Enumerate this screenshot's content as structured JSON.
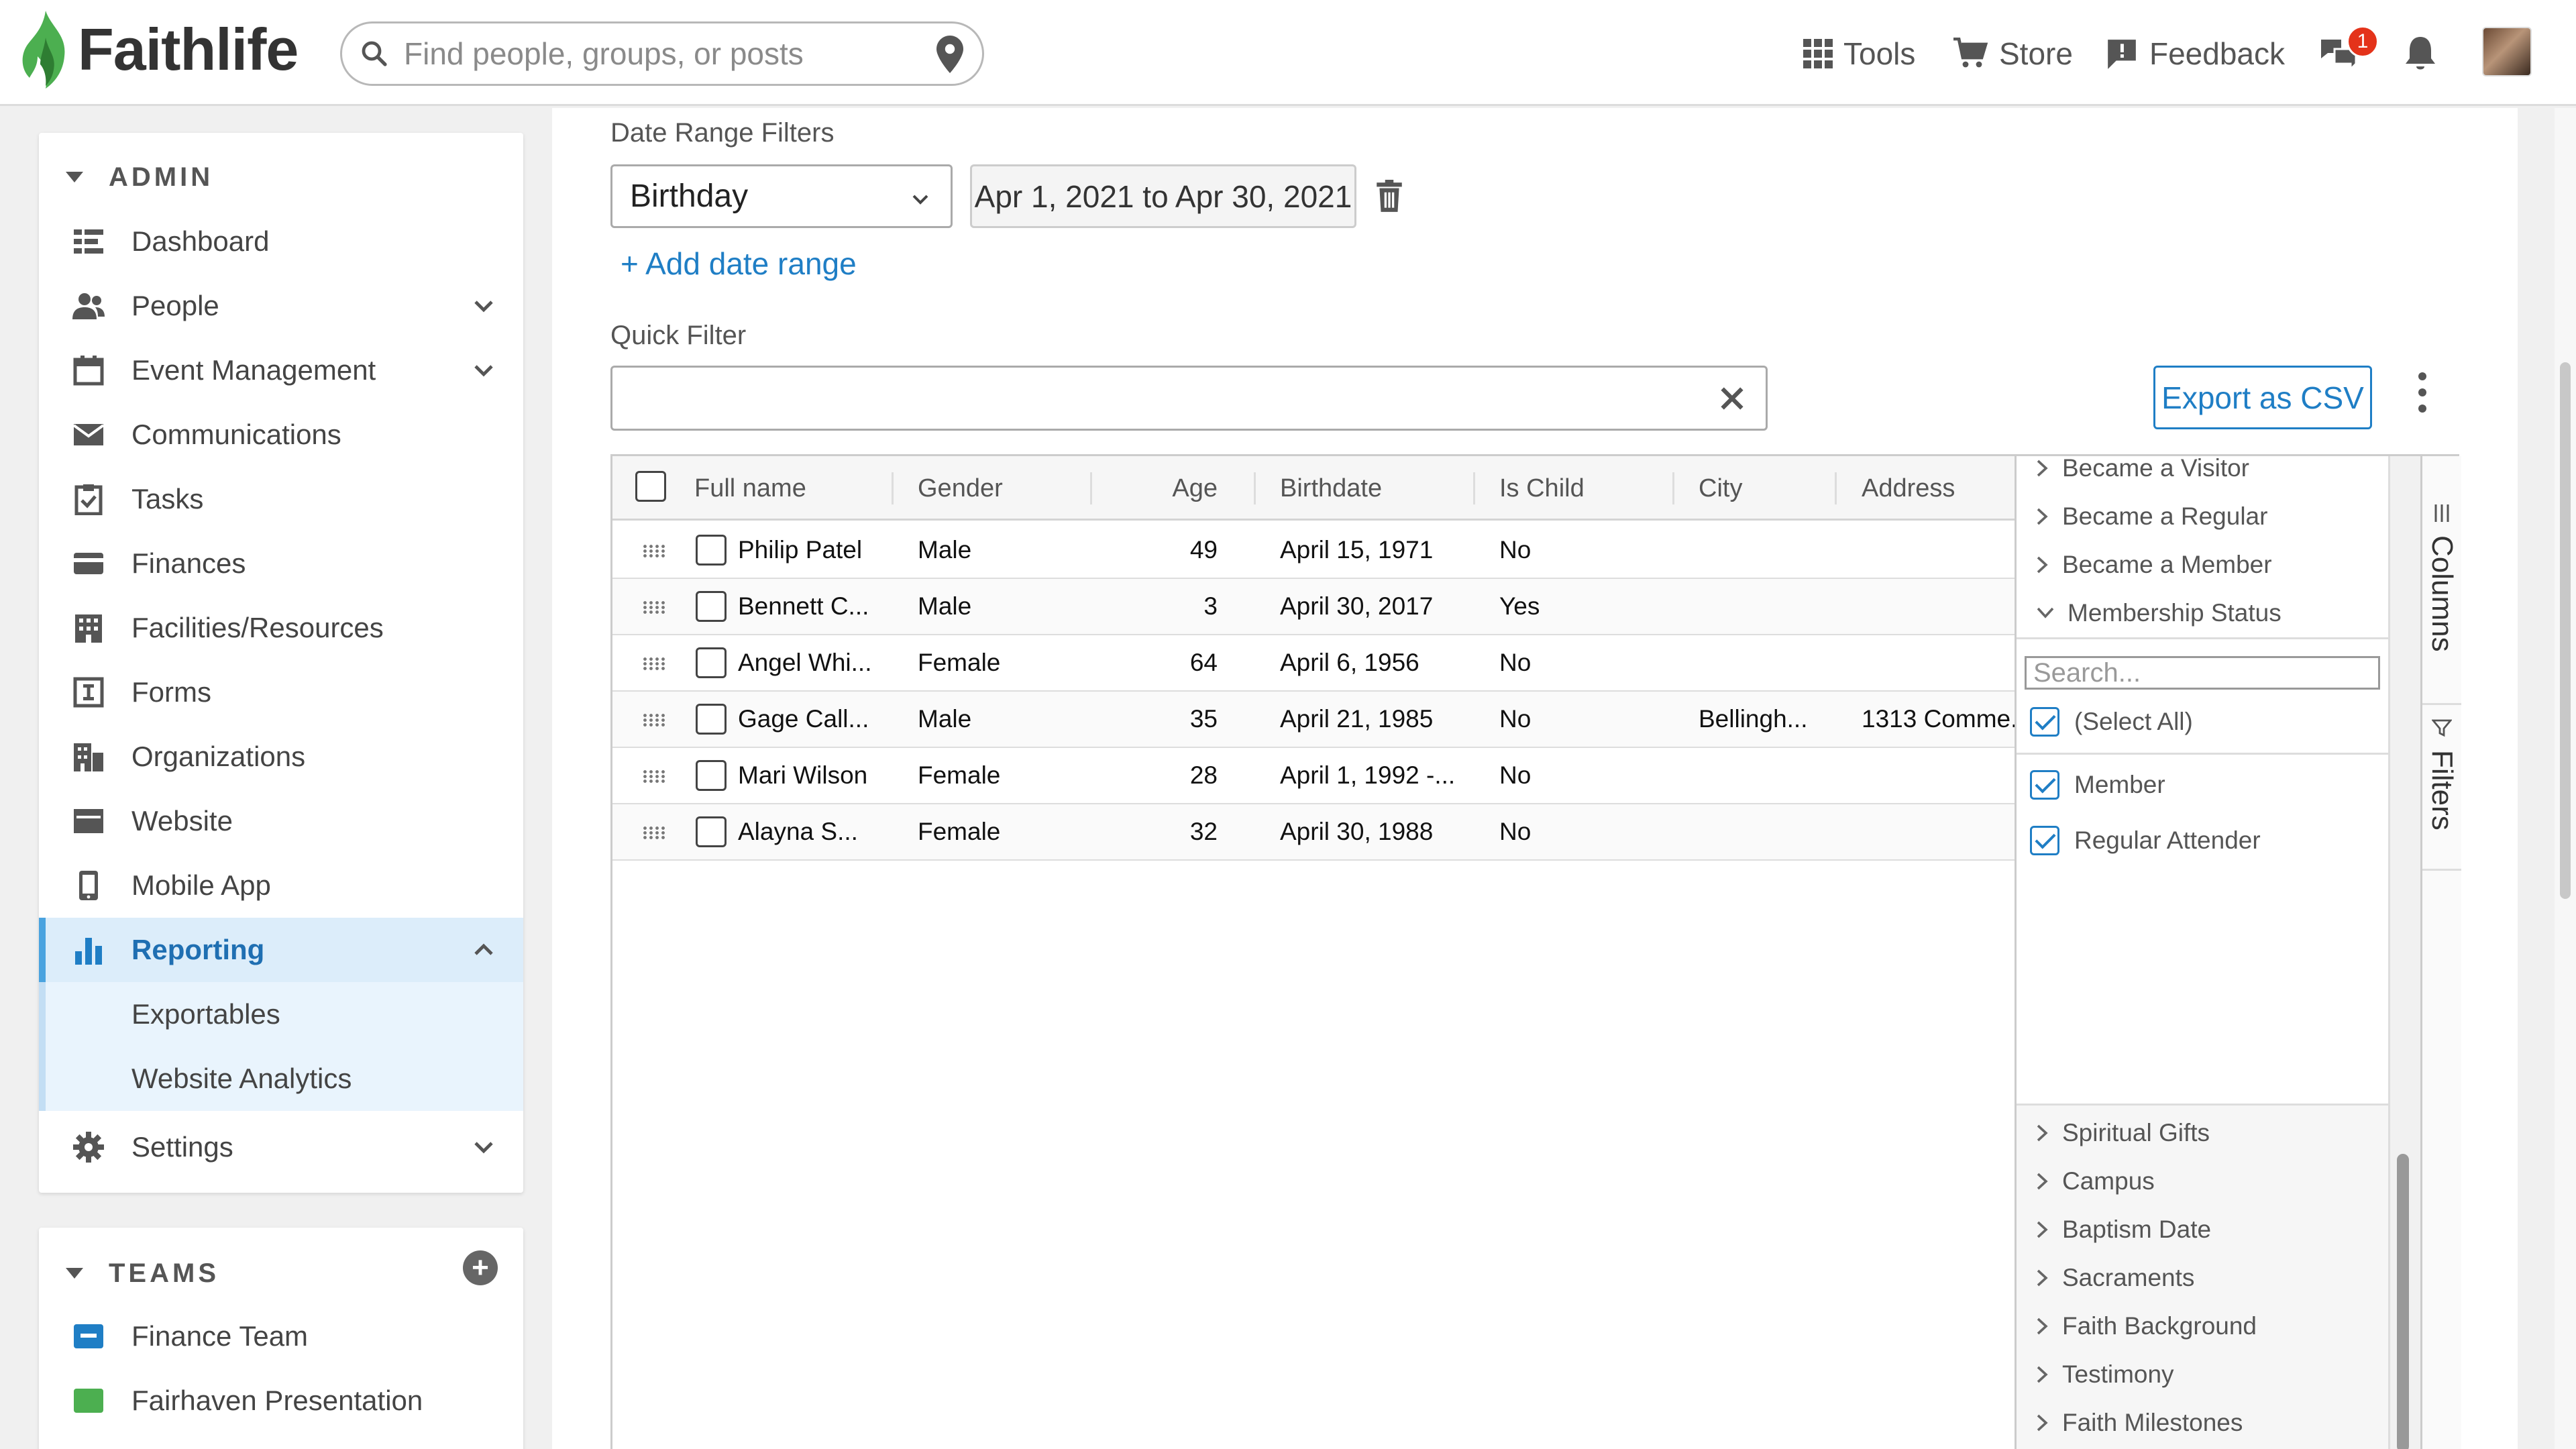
{
  "brand": {
    "name": "Faithlife",
    "accent": "#1f7ec5",
    "logo_green": "#4caf50"
  },
  "search": {
    "placeholder": "Find people, groups, or posts"
  },
  "topnav": {
    "tools_label": "Tools",
    "store_label": "Store",
    "feedback_label": "Feedback",
    "notifications_count": "1"
  },
  "sidebar": {
    "admin_heading": "ADMIN",
    "items": [
      {
        "label": "Dashboard",
        "icon": "dashboard-icon"
      },
      {
        "label": "People",
        "icon": "people-icon"
      },
      {
        "label": "Event Management",
        "icon": "calendar-icon"
      },
      {
        "label": "Communications",
        "icon": "envelope-icon"
      },
      {
        "label": "Tasks",
        "icon": "clipboard-check-icon"
      },
      {
        "label": "Finances",
        "icon": "credit-card-icon"
      },
      {
        "label": "Facilities/Resources",
        "icon": "building-icon"
      },
      {
        "label": "Forms",
        "icon": "form-icon"
      },
      {
        "label": "Organizations",
        "icon": "organization-icon"
      },
      {
        "label": "Website",
        "icon": "browser-icon"
      },
      {
        "label": "Mobile App",
        "icon": "mobile-icon"
      },
      {
        "label": "Reporting",
        "icon": "bar-chart-icon"
      },
      {
        "label": "Exportables"
      },
      {
        "label": "Website Analytics"
      },
      {
        "label": "Settings",
        "icon": "gear-icon"
      }
    ],
    "teams_heading": "TEAMS",
    "teams": [
      {
        "label": "Finance Team",
        "color": "#1f7ec5"
      },
      {
        "label": "Fairhaven Presentation",
        "color": "#4caf50"
      }
    ]
  },
  "filters": {
    "date_range_label": "Date Range Filters",
    "date_field_value": "Birthday",
    "date_range_value": "Apr 1, 2021 to Apr 30, 2021",
    "add_date_range": "+ Add date range",
    "quick_filter_label": "Quick Filter",
    "quick_filter_value": "",
    "export_label": "Export as CSV"
  },
  "grid": {
    "columns": [
      "Full name",
      "Gender",
      "Age",
      "Birthdate",
      "Is Child",
      "City",
      "Address"
    ],
    "rows": [
      {
        "name": "Philip Patel",
        "gender": "Male",
        "age": "49",
        "birthdate": "April 15, 1971",
        "is_child": "No",
        "city": "",
        "address": ""
      },
      {
        "name": "Bennett C...",
        "gender": "Male",
        "age": "3",
        "birthdate": "April 30, 2017",
        "is_child": "Yes",
        "city": "",
        "address": ""
      },
      {
        "name": "Angel Whi...",
        "gender": "Female",
        "age": "64",
        "birthdate": "April 6, 1956",
        "is_child": "No",
        "city": "",
        "address": ""
      },
      {
        "name": "Gage Call...",
        "gender": "Male",
        "age": "35",
        "birthdate": "April 21, 1985",
        "is_child": "No",
        "city": "Bellingh...",
        "address": "1313 Comme..."
      },
      {
        "name": "Mari Wilson",
        "gender": "Female",
        "age": "28",
        "birthdate": "April 1, 1992 -...",
        "is_child": "No",
        "city": "",
        "address": ""
      },
      {
        "name": "Alayna S...",
        "gender": "Female",
        "age": "32",
        "birthdate": "April 30, 1988",
        "is_child": "No",
        "city": "",
        "address": ""
      }
    ]
  },
  "tool_panel": {
    "upper_groups": [
      "Became a Visitor",
      "Became a Regular",
      "Became a Member",
      "Membership Status"
    ],
    "search_placeholder": "Search...",
    "select_all": "(Select All)",
    "options": [
      "Member",
      "Regular Attender"
    ],
    "lower_groups": [
      "Spiritual Gifts",
      "Campus",
      "Baptism Date",
      "Sacraments",
      "Faith Background",
      "Testimony",
      "Faith Milestones"
    ],
    "tabs": [
      "Columns",
      "Filters"
    ]
  }
}
